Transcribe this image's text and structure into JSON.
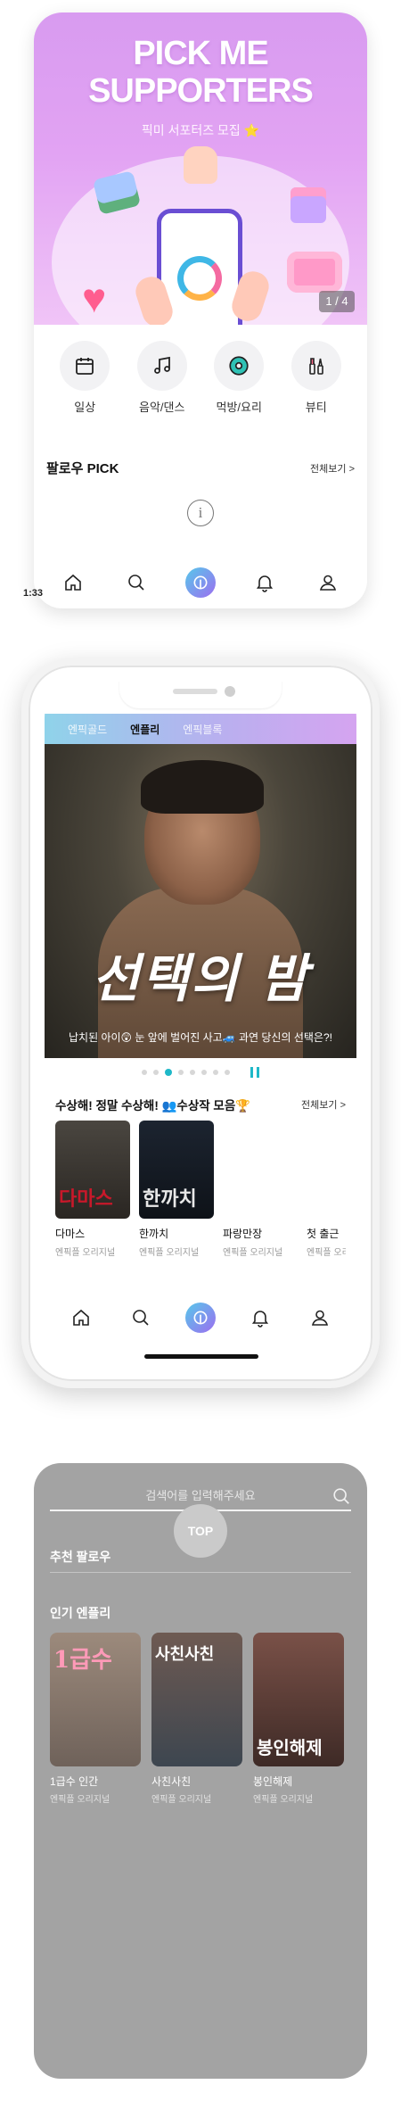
{
  "panel1": {
    "hero": {
      "title_line1": "PICK ME",
      "title_line2": "SUPPORTERS",
      "subtitle": "픽미 서포터즈 모집 ⭐",
      "page_indicator": "1 / 4"
    },
    "categories": [
      {
        "label": "일상",
        "icon": "calendar-icon"
      },
      {
        "label": "음악/댄스",
        "icon": "music-note-icon"
      },
      {
        "label": "먹방/요리",
        "icon": "donut-icon"
      },
      {
        "label": "뷰티",
        "icon": "makeup-brush-icon"
      }
    ],
    "follow_section": {
      "title": "팔로우 PICK",
      "see_all": "전체보기 >"
    },
    "nav": [
      "home-icon",
      "search-icon",
      "play-logo-icon",
      "bell-icon",
      "profile-icon"
    ],
    "status_time": "1:33"
  },
  "panel2": {
    "tabs": [
      {
        "label": "엔픽골드",
        "active": false
      },
      {
        "label": "엔플리",
        "active": true
      },
      {
        "label": "엔픽블록",
        "active": false
      }
    ],
    "banner": {
      "title": "선택의 밤",
      "caption": "납치된 아이😲 눈 앞에 벌어진 사고🚙 과연 당신의 선택은?!"
    },
    "carousel": {
      "dot_count": 8,
      "active_index": 2
    },
    "award_section": {
      "title": "수상해! 정말 수상해! 👥수상작 모음🏆",
      "see_all": "전체보기 >",
      "items": [
        {
          "title": "다마스",
          "subtitle": "엔픽플 오리지널",
          "thumb_text": "다마스",
          "thumb_color": "#c8182a"
        },
        {
          "title": "한까치",
          "subtitle": "엔픽플 오리지널",
          "thumb_text": "한까치",
          "thumb_color": "#e8e8e8"
        },
        {
          "title": "파랑만장",
          "subtitle": "엔픽플 오리지널"
        },
        {
          "title": "첫 출근",
          "subtitle": "엔픽플 오리지널"
        }
      ]
    },
    "nav": [
      "home-icon",
      "search-icon",
      "play-logo-icon",
      "bell-icon",
      "profile-icon"
    ]
  },
  "panel3": {
    "search_placeholder": "검색어를 입력해주세요",
    "top_button": "TOP",
    "recommend_title": "추천 팔로우",
    "popular_title": "인기 엔플리",
    "popular_items": [
      {
        "title": "1급수 인간",
        "subtitle": "엔픽플 오리지널",
        "thumb_text": "1급수"
      },
      {
        "title": "사친사친",
        "subtitle": "엔픽플 오리지널",
        "thumb_text": "사친사친"
      },
      {
        "title": "봉인해제",
        "subtitle": "엔픽플 오리지널",
        "thumb_text": "봉인해제"
      }
    ]
  },
  "colors": {
    "brand_teal": "#1fb8c8",
    "brand_purple": "#9c6ef0",
    "hero_pink": "#e2a3f3"
  }
}
